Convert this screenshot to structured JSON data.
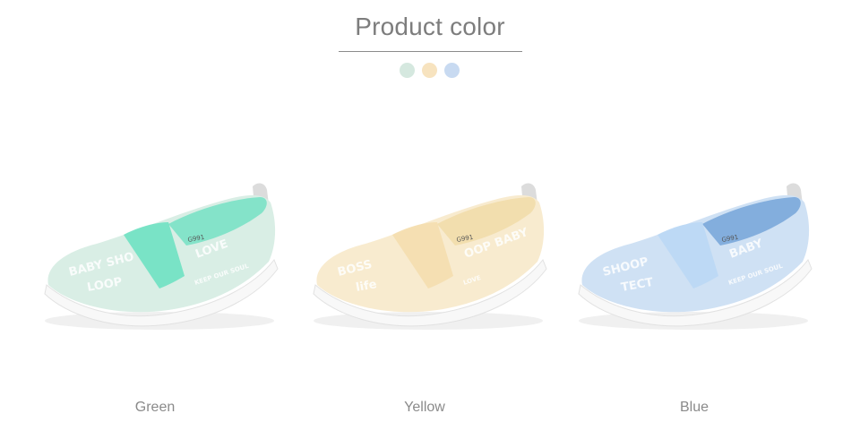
{
  "header": {
    "title": "Product color",
    "swatches": [
      {
        "name": "green",
        "color": "#d5e8df"
      },
      {
        "name": "yellow",
        "color": "#f7e3bf"
      },
      {
        "name": "blue",
        "color": "#c8daf1"
      }
    ]
  },
  "products": [
    {
      "label": "Green",
      "model": "G991",
      "colors": {
        "body": "#d9eee5",
        "band": "#74e1c4",
        "lining": "#74e1c4",
        "sole": "#f8f8f8",
        "print": "#ffffff"
      },
      "print_text": [
        "BABY SHO",
        "LOVE",
        "LOOP",
        "KEEP OUR SOUL"
      ]
    },
    {
      "label": "Yellow",
      "model": "G991",
      "colors": {
        "body": "#f8ebcf",
        "band": "#f4deb0",
        "lining": "#f1dca8",
        "sole": "#f8f8f8",
        "print": "#ffffff"
      },
      "print_text": [
        "BOSS",
        "OOP BABY",
        "life",
        "LOVE"
      ]
    },
    {
      "label": "Blue",
      "model": "G991",
      "colors": {
        "body": "#cfe1f4",
        "band": "#bcd8f4",
        "lining": "#75a5d8",
        "sole": "#f8f8f8",
        "print": "#ffffff"
      },
      "print_text": [
        "SHOOP",
        "BABY",
        "TECT",
        "KEEP OUR SOUL"
      ]
    }
  ]
}
